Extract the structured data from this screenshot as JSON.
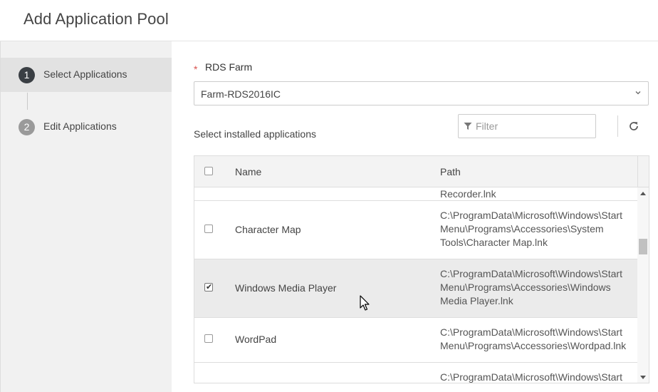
{
  "dialog": {
    "title": "Add Application Pool"
  },
  "wizard": {
    "steps": [
      {
        "number": "1",
        "label": "Select Applications",
        "state": "active"
      },
      {
        "number": "2",
        "label": "Edit Applications",
        "state": "inactive"
      }
    ]
  },
  "form": {
    "farm_required_marker": "*",
    "farm_label": "RDS Farm",
    "farm_value": "Farm-RDS2016IC",
    "section_label": "Select installed applications",
    "filter_placeholder": "Filter"
  },
  "table": {
    "columns": {
      "name": "Name",
      "path": "Path"
    },
    "rows": [
      {
        "name": "",
        "path": [
          "Recorder.lnk"
        ],
        "checked": false,
        "selected": false,
        "partial": true
      },
      {
        "name": "Character Map",
        "path": [
          "C:\\ProgramData\\Microsoft\\Windows\\Start",
          "Menu\\Programs\\Accessories\\System",
          "Tools\\Character Map.lnk"
        ],
        "checked": false,
        "selected": false
      },
      {
        "name": "Windows Media Player",
        "path": [
          "C:\\ProgramData\\Microsoft\\Windows\\Start",
          "Menu\\Programs\\Accessories\\Windows",
          "Media Player.lnk"
        ],
        "checked": true,
        "selected": true
      },
      {
        "name": "WordPad",
        "path": [
          "C:\\ProgramData\\Microsoft\\Windows\\Start",
          "Menu\\Programs\\Accessories\\Wordpad.lnk"
        ],
        "checked": false,
        "selected": false
      },
      {
        "name": "",
        "path": [
          "C:\\ProgramData\\Microsoft\\Windows\\Start"
        ],
        "checked": false,
        "selected": false,
        "partial": true
      }
    ]
  },
  "icons": {
    "chevron": "chevron-down-icon",
    "filter": "filter-icon",
    "refresh": "refresh-icon",
    "cursor": "mouse-cursor-icon"
  },
  "colors": {
    "step_active_bg": "#3a3f44",
    "step_inactive_bg": "#9a9a9a",
    "required": "#d9534f",
    "selected_row": "#ebebeb"
  }
}
